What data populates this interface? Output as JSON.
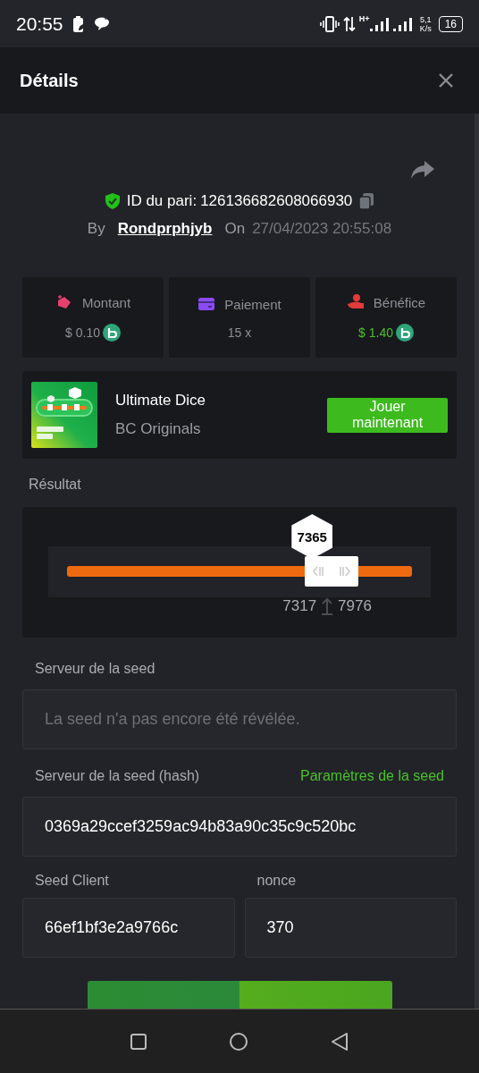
{
  "status_bar": {
    "time": "20:55",
    "network_type": "H+",
    "speed": "5,1",
    "speed_unit": "K/s",
    "battery": "16"
  },
  "header": {
    "title": "Détails"
  },
  "bet": {
    "id_label": "ID du pari:",
    "id": "126136682608066930",
    "by_label": "By",
    "user": "Rondprphjyb",
    "on_label": "On",
    "date": "27/04/2023 20:55:08"
  },
  "stats": [
    {
      "kind": "amount",
      "label": "Montant",
      "value": "$ 0.10",
      "coin": true,
      "highlight": false
    },
    {
      "kind": "payout",
      "label": "Paiement",
      "value": "15 x",
      "coin": false,
      "highlight": false
    },
    {
      "kind": "profit",
      "label": "Bénéfice",
      "value": "$ 1.40",
      "coin": true,
      "highlight": true
    }
  ],
  "game": {
    "name": "Ultimate Dice",
    "provider": "BC Originals",
    "play_button": "Jouer maintenant"
  },
  "result": {
    "label": "Résultat",
    "value": "7365",
    "level": 0.7365,
    "range_low": "7317",
    "range_high": "7976"
  },
  "server_seed": {
    "label": "Serveur de la seed",
    "placeholder": "La seed n'a pas encore été révélée."
  },
  "server_seed_hash": {
    "label": "Serveur de la seed (hash)",
    "link": "Paramètres de la seed",
    "value": "0369a29ccef3259ac94b83a90c35c9c520bc"
  },
  "client_seed": {
    "label": "Seed Client",
    "value": "66ef1bf3e2a9766c"
  },
  "nonce": {
    "label": "nonce",
    "value": "370"
  }
}
